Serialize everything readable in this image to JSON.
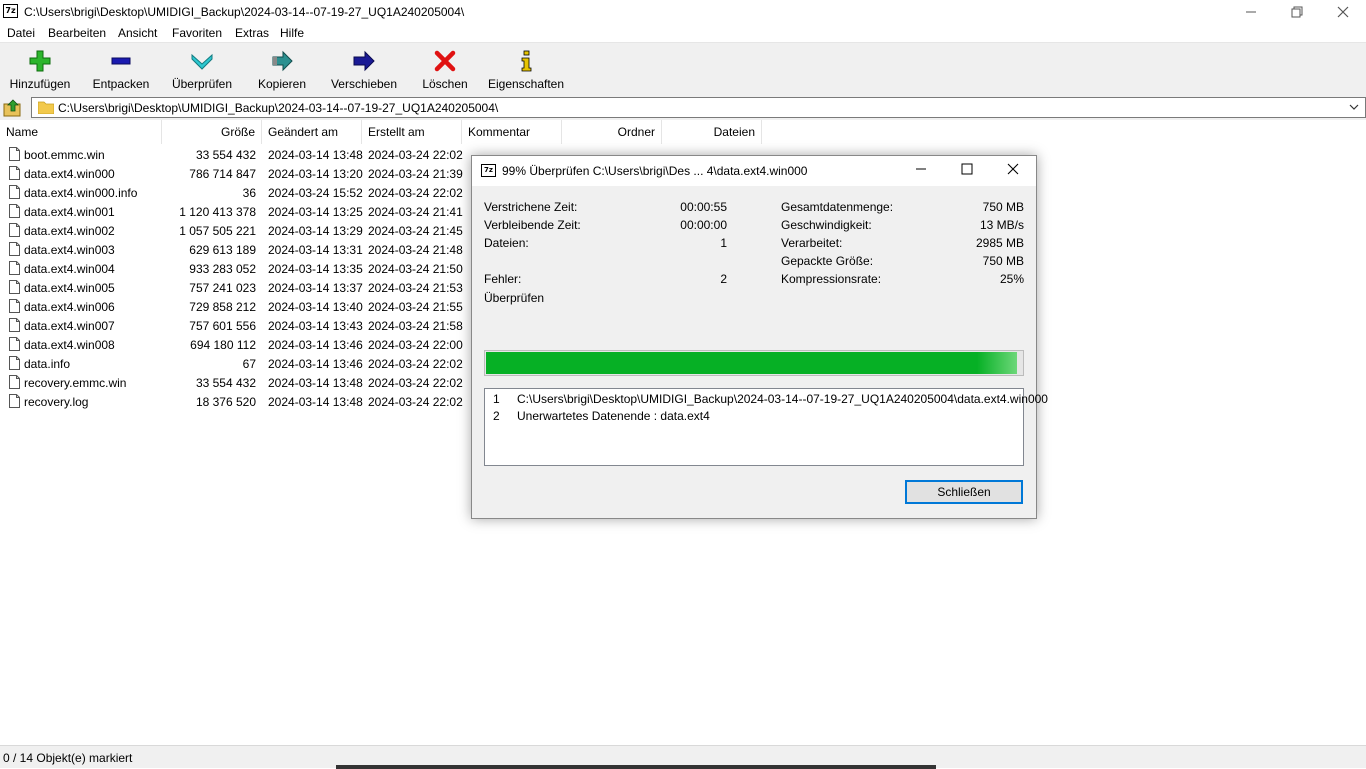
{
  "window": {
    "title": "C:\\Users\\brigi\\Desktop\\UMIDIGI_Backup\\2024-03-14--07-19-27_UQ1A240205004\\",
    "app_icon_text": "7z"
  },
  "menu": [
    "Datei",
    "Bearbeiten",
    "Ansicht",
    "Favoriten",
    "Extras",
    "Hilfe"
  ],
  "toolbar": [
    {
      "label": "Hinzufügen",
      "icon": "plus-icon",
      "color": "#22aa22"
    },
    {
      "label": "Entpacken",
      "icon": "minus-icon",
      "color": "#1a1aa0"
    },
    {
      "label": "Überprüfen",
      "icon": "check-chevron-icon",
      "color": "#29c4c4"
    },
    {
      "label": "Kopieren",
      "icon": "copy-arrow-icon",
      "color": "#2a8a8a"
    },
    {
      "label": "Verschieben",
      "icon": "move-arrow-icon",
      "color": "#1a1a90"
    },
    {
      "label": "Löschen",
      "icon": "delete-x-icon",
      "color": "#e01010"
    },
    {
      "label": "Eigenschaften",
      "icon": "info-icon",
      "color": "#e0c000"
    }
  ],
  "address": {
    "path": "C:\\Users\\brigi\\Desktop\\UMIDIGI_Backup\\2024-03-14--07-19-27_UQ1A240205004\\"
  },
  "columns": [
    "Name",
    "Größe",
    "Geändert am",
    "Erstellt am",
    "Kommentar",
    "Ordner",
    "Dateien"
  ],
  "files": [
    {
      "name": "boot.emmc.win",
      "size": "33 554 432",
      "modified": "2024-03-14 13:48",
      "created": "2024-03-24 22:02"
    },
    {
      "name": "data.ext4.win000",
      "size": "786 714 847",
      "modified": "2024-03-14 13:20",
      "created": "2024-03-24 21:39"
    },
    {
      "name": "data.ext4.win000.info",
      "size": "36",
      "modified": "2024-03-24 15:52",
      "created": "2024-03-24 22:02"
    },
    {
      "name": "data.ext4.win001",
      "size": "1 120 413 378",
      "modified": "2024-03-14 13:25",
      "created": "2024-03-24 21:41"
    },
    {
      "name": "data.ext4.win002",
      "size": "1 057 505 221",
      "modified": "2024-03-14 13:29",
      "created": "2024-03-24 21:45"
    },
    {
      "name": "data.ext4.win003",
      "size": "629 613 189",
      "modified": "2024-03-14 13:31",
      "created": "2024-03-24 21:48"
    },
    {
      "name": "data.ext4.win004",
      "size": "933 283 052",
      "modified": "2024-03-14 13:35",
      "created": "2024-03-24 21:50"
    },
    {
      "name": "data.ext4.win005",
      "size": "757 241 023",
      "modified": "2024-03-14 13:37",
      "created": "2024-03-24 21:53"
    },
    {
      "name": "data.ext4.win006",
      "size": "729 858 212",
      "modified": "2024-03-14 13:40",
      "created": "2024-03-24 21:55"
    },
    {
      "name": "data.ext4.win007",
      "size": "757 601 556",
      "modified": "2024-03-14 13:43",
      "created": "2024-03-24 21:58"
    },
    {
      "name": "data.ext4.win008",
      "size": "694 180 112",
      "modified": "2024-03-14 13:46",
      "created": "2024-03-24 22:00"
    },
    {
      "name": "data.info",
      "size": "67",
      "modified": "2024-03-14 13:46",
      "created": "2024-03-24 22:02"
    },
    {
      "name": "recovery.emmc.win",
      "size": "33 554 432",
      "modified": "2024-03-14 13:48",
      "created": "2024-03-24 22:02"
    },
    {
      "name": "recovery.log",
      "size": "18 376 520",
      "modified": "2024-03-14 13:48",
      "created": "2024-03-24 22:02"
    }
  ],
  "status": {
    "text": "0 / 14 Objekt(e) markiert"
  },
  "dialog": {
    "title": "99% Überprüfen C:\\Users\\brigi\\Des ... 4\\data.ext4.win000",
    "left": [
      {
        "label": "Verstrichene Zeit:",
        "value": "00:00:55"
      },
      {
        "label": "Verbleibende Zeit:",
        "value": "00:00:00"
      },
      {
        "label": "Dateien:",
        "value": "1"
      },
      {
        "label": "Fehler:",
        "value": "2"
      }
    ],
    "right": [
      {
        "label": "Gesamtdatenmenge:",
        "value": "750 MB"
      },
      {
        "label": "Geschwindigkeit:",
        "value": "13 MB/s"
      },
      {
        "label": "Verarbeitet:",
        "value": "2985 MB"
      },
      {
        "label": "Gepackte Größe:",
        "value": "750 MB"
      },
      {
        "label": "Kompressionsrate:",
        "value": "25%"
      }
    ],
    "operation": "Überprüfen",
    "progress_percent": 99,
    "progress_color": "#06b025",
    "messages": [
      {
        "num": "1",
        "text": "C:\\Users\\brigi\\Desktop\\UMIDIGI_Backup\\2024-03-14--07-19-27_UQ1A240205004\\data.ext4.win000"
      },
      {
        "num": "2",
        "text": "Unerwartetes Datenende : data.ext4"
      }
    ],
    "close_label": "Schließen"
  }
}
